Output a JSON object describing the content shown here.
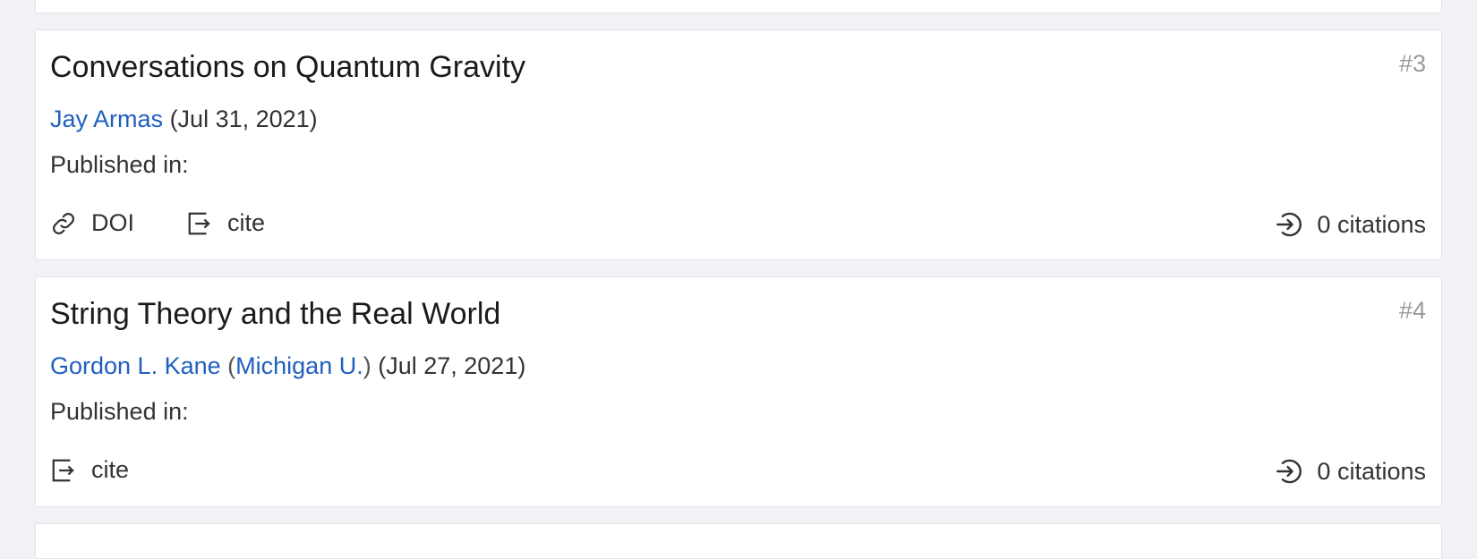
{
  "results": [
    {
      "rank": "#3",
      "title": "Conversations on Quantum Gravity",
      "author": "Jay Armas",
      "date": "(Jul 31, 2021)",
      "published_label": "Published in:",
      "doi_label": "DOI",
      "cite_label": "cite",
      "citations_label": "0 citations"
    },
    {
      "rank": "#4",
      "title": "String Theory and the Real World",
      "author": "Gordon L. Kane",
      "affiliation": "Michigan U.",
      "date": "(Jul 27, 2021)",
      "published_label": "Published in:",
      "cite_label": "cite",
      "citations_label": "0 citations"
    }
  ],
  "colors": {
    "link": "#1f5fbf",
    "rank": "#9a9a9a",
    "background": "#f0f2f5"
  },
  "icons": {
    "doi": "link-icon",
    "cite": "cite-export-icon",
    "citations": "login-arrow-circle-icon"
  }
}
